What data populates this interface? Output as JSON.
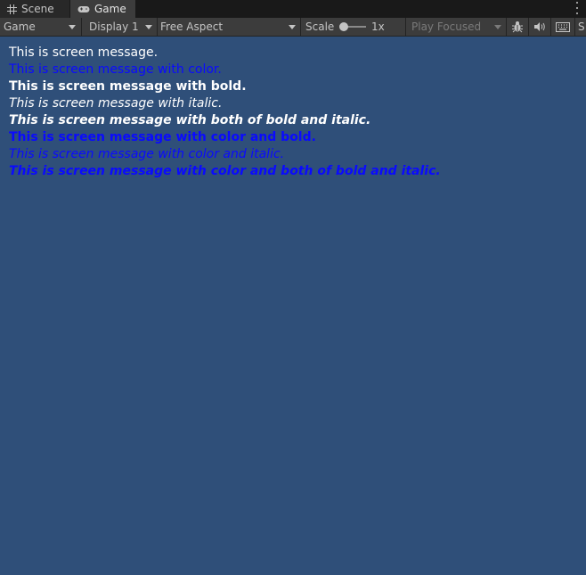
{
  "tabs": [
    {
      "label": "Scene",
      "icon": "grid-icon"
    },
    {
      "label": "Game",
      "icon": "gamepad-icon"
    }
  ],
  "toolbar": {
    "view": "Game",
    "display": "Display 1",
    "aspect": "Free Aspect",
    "scale_label": "Scale",
    "scale_value": "1x",
    "scale_level": 0.0,
    "play_mode": "Play Focused",
    "cut_label": "S",
    "icons": [
      "bug-icon",
      "audio-icon",
      "keyboard-icon"
    ]
  },
  "messages": [
    {
      "text": "This is screen message.",
      "color": "#ffffff",
      "bold": false,
      "italic": false
    },
    {
      "text": "This is screen message with color.",
      "color": "#0a0aff",
      "bold": false,
      "italic": false
    },
    {
      "text": "This is screen message with bold.",
      "color": "#ffffff",
      "bold": true,
      "italic": false
    },
    {
      "text": "This is screen message with italic.",
      "color": "#ffffff",
      "bold": false,
      "italic": true
    },
    {
      "text": "This is screen message with both of bold and italic.",
      "color": "#ffffff",
      "bold": true,
      "italic": true
    },
    {
      "text": "This is screen message with color and bold.",
      "color": "#0a0aff",
      "bold": true,
      "italic": false
    },
    {
      "text": "This is screen message with color and italic.",
      "color": "#0a0aff",
      "bold": false,
      "italic": true
    },
    {
      "text": "This is screen message with color and both of bold and italic.",
      "color": "#0a0aff",
      "bold": true,
      "italic": true
    }
  ],
  "colors": {
    "background": "#2f4f79",
    "toolbar": "#3c3c3c",
    "tabbar": "#191919"
  }
}
